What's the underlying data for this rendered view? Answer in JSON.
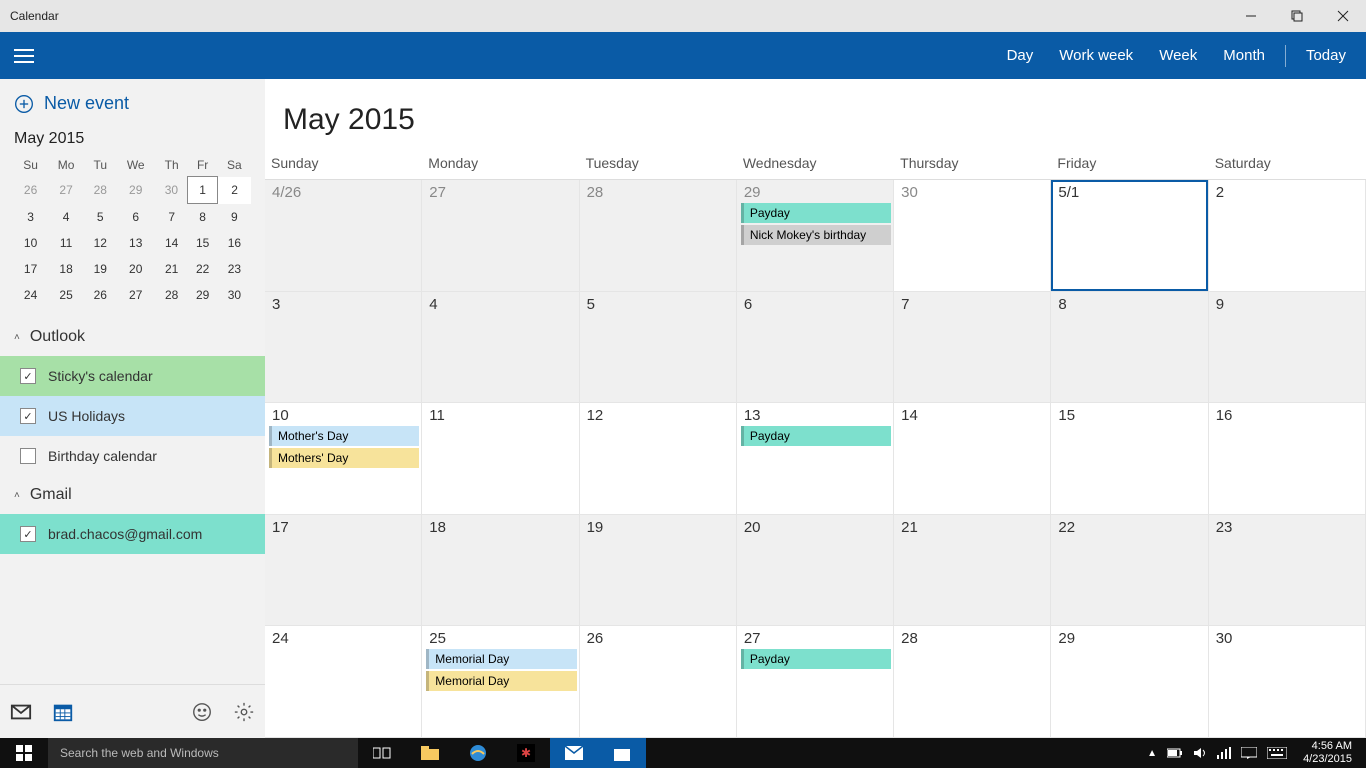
{
  "window": {
    "title": "Calendar"
  },
  "viewbar": {
    "day": "Day",
    "workweek": "Work week",
    "week": "Week",
    "month": "Month",
    "today": "Today"
  },
  "sidebar": {
    "new_event": "New event",
    "mini_title": "May 2015",
    "dow": [
      "Su",
      "Mo",
      "Tu",
      "We",
      "Th",
      "Fr",
      "Sa"
    ],
    "mini_rows": [
      [
        {
          "d": "26",
          "o": true
        },
        {
          "d": "27",
          "o": true
        },
        {
          "d": "28",
          "o": true
        },
        {
          "d": "29",
          "o": true
        },
        {
          "d": "30",
          "o": true
        },
        {
          "d": "1",
          "today": true
        },
        {
          "d": "2",
          "hl": true
        }
      ],
      [
        {
          "d": "3"
        },
        {
          "d": "4"
        },
        {
          "d": "5"
        },
        {
          "d": "6"
        },
        {
          "d": "7"
        },
        {
          "d": "8"
        },
        {
          "d": "9"
        }
      ],
      [
        {
          "d": "10"
        },
        {
          "d": "11"
        },
        {
          "d": "12"
        },
        {
          "d": "13"
        },
        {
          "d": "14"
        },
        {
          "d": "15"
        },
        {
          "d": "16"
        }
      ],
      [
        {
          "d": "17"
        },
        {
          "d": "18"
        },
        {
          "d": "19"
        },
        {
          "d": "20"
        },
        {
          "d": "21"
        },
        {
          "d": "22"
        },
        {
          "d": "23"
        }
      ],
      [
        {
          "d": "24"
        },
        {
          "d": "25"
        },
        {
          "d": "26"
        },
        {
          "d": "27"
        },
        {
          "d": "28"
        },
        {
          "d": "29"
        },
        {
          "d": "30"
        }
      ]
    ],
    "groups": {
      "outlook": "Outlook",
      "gmail": "Gmail"
    },
    "calendars": {
      "sticky": {
        "label": "Sticky's calendar",
        "checked": true
      },
      "usholidays": {
        "label": "US Holidays",
        "checked": true
      },
      "birthday": {
        "label": "Birthday calendar",
        "checked": false
      },
      "gmail": {
        "label": "brad.chacos@gmail.com",
        "checked": true
      }
    }
  },
  "month": {
    "title": "May 2015",
    "dow": [
      "Sunday",
      "Monday",
      "Tuesday",
      "Wednesday",
      "Thursday",
      "Friday",
      "Saturday"
    ],
    "cells": [
      {
        "d": "4/26",
        "in": false
      },
      {
        "d": "27",
        "in": false
      },
      {
        "d": "28",
        "in": false
      },
      {
        "d": "29",
        "in": false,
        "events": [
          {
            "t": "Payday",
            "c": "ev-teal"
          },
          {
            "t": "Nick Mokey's birthday",
            "c": "ev-gray"
          }
        ]
      },
      {
        "d": "30",
        "in": false,
        "bg": "white"
      },
      {
        "d": "5/1",
        "in": true,
        "today": true
      },
      {
        "d": "2",
        "in": true
      },
      {
        "d": "3",
        "in": true,
        "alt": true
      },
      {
        "d": "4",
        "in": true,
        "alt": true
      },
      {
        "d": "5",
        "in": true,
        "alt": true
      },
      {
        "d": "6",
        "in": true,
        "alt": true
      },
      {
        "d": "7",
        "in": true,
        "alt": true
      },
      {
        "d": "8",
        "in": true,
        "alt": true
      },
      {
        "d": "9",
        "in": true,
        "alt": true
      },
      {
        "d": "10",
        "in": true,
        "events": [
          {
            "t": "Mother's Day",
            "c": "ev-blue"
          },
          {
            "t": "Mothers' Day",
            "c": "ev-yellow"
          }
        ]
      },
      {
        "d": "11",
        "in": true
      },
      {
        "d": "12",
        "in": true
      },
      {
        "d": "13",
        "in": true,
        "events": [
          {
            "t": "Payday",
            "c": "ev-teal"
          }
        ]
      },
      {
        "d": "14",
        "in": true
      },
      {
        "d": "15",
        "in": true
      },
      {
        "d": "16",
        "in": true
      },
      {
        "d": "17",
        "in": true,
        "alt": true
      },
      {
        "d": "18",
        "in": true,
        "alt": true
      },
      {
        "d": "19",
        "in": true,
        "alt": true
      },
      {
        "d": "20",
        "in": true,
        "alt": true
      },
      {
        "d": "21",
        "in": true,
        "alt": true
      },
      {
        "d": "22",
        "in": true,
        "alt": true
      },
      {
        "d": "23",
        "in": true,
        "alt": true
      },
      {
        "d": "24",
        "in": true
      },
      {
        "d": "25",
        "in": true,
        "events": [
          {
            "t": "Memorial Day",
            "c": "ev-blue"
          },
          {
            "t": "Memorial Day",
            "c": "ev-yellow"
          }
        ]
      },
      {
        "d": "26",
        "in": true
      },
      {
        "d": "27",
        "in": true,
        "events": [
          {
            "t": "Payday",
            "c": "ev-teal"
          }
        ]
      },
      {
        "d": "28",
        "in": true
      },
      {
        "d": "29",
        "in": true
      },
      {
        "d": "30",
        "in": true
      }
    ]
  },
  "taskbar": {
    "search_placeholder": "Search the web and Windows",
    "time": "4:56 AM",
    "date": "4/23/2015"
  }
}
